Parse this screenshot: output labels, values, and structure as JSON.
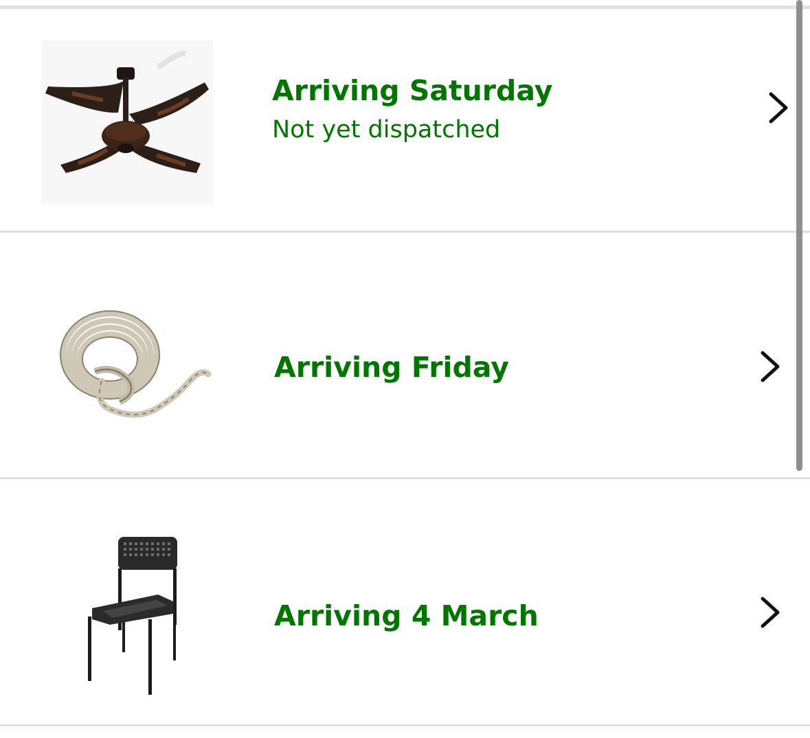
{
  "orders": [
    {
      "product_icon": "ceiling-fan-image",
      "arrival": "Arriving Saturday",
      "substatus": "Not yet dispatched"
    },
    {
      "product_icon": "rope-coil-image",
      "arrival": "Arriving Friday",
      "substatus": ""
    },
    {
      "product_icon": "chair-image",
      "arrival": "Arriving 4 March",
      "substatus": ""
    }
  ],
  "colors": {
    "status_green": "#007600",
    "divider": "#dcdee1",
    "chevron": "#111111",
    "scrollbar": "#8e8e93"
  },
  "icons": {
    "row_action": "chevron-right-icon"
  }
}
